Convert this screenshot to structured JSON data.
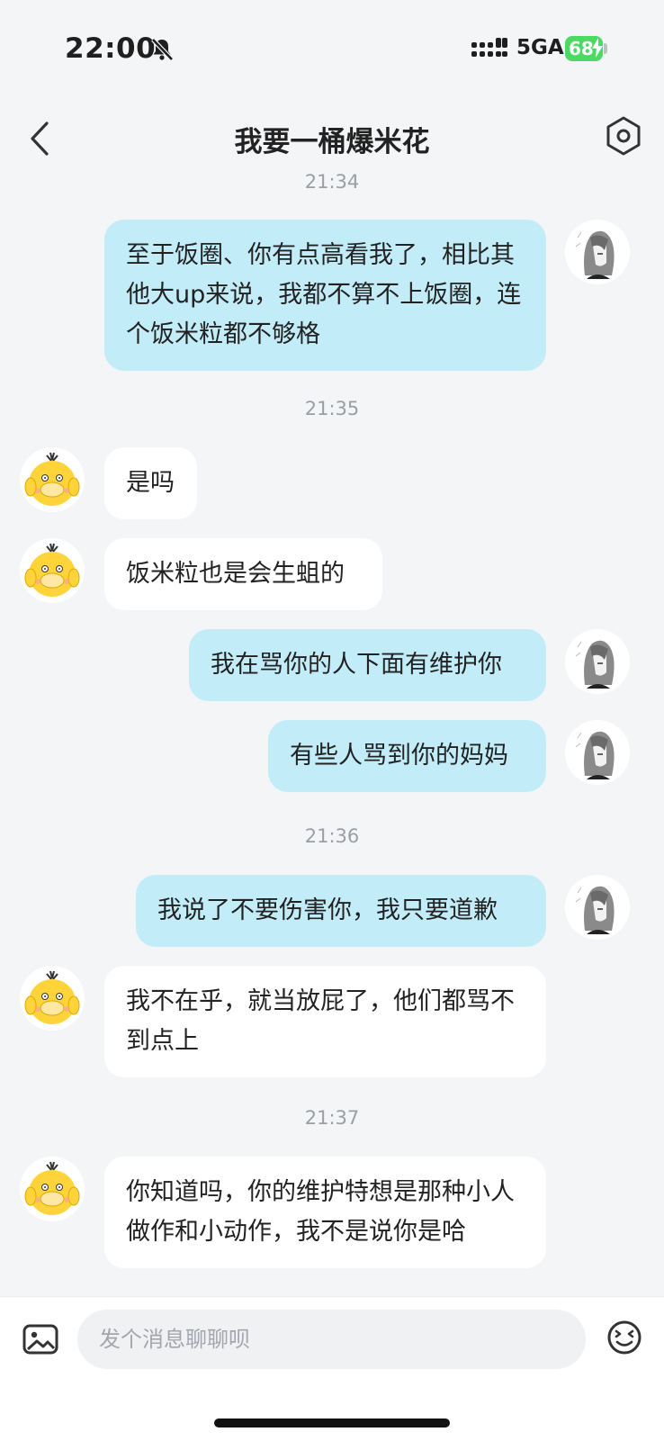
{
  "status_bar": {
    "time": "22:00",
    "network": "5GA",
    "battery": "68"
  },
  "header": {
    "title": "我要一桶爆米花",
    "back_icon": "chevron-left-icon",
    "settings_icon": "gear-icon"
  },
  "messages": [
    {
      "type": "time",
      "text": "21:34"
    },
    {
      "type": "out",
      "text": "至于饭圈、你有点高看我了，相比其他大up来说，我都不算不上饭圈，连个饭米粒都不够格"
    },
    {
      "type": "time",
      "text": "21:35"
    },
    {
      "type": "in",
      "text": "是吗"
    },
    {
      "type": "in",
      "text": "饭米粒也是会生蛆的"
    },
    {
      "type": "out",
      "text": "我在骂你的人下面有维护你"
    },
    {
      "type": "out",
      "text": "有些人骂到你的妈妈"
    },
    {
      "type": "time",
      "text": "21:36"
    },
    {
      "type": "out",
      "text": "我说了不要伤害你，我只要道歉"
    },
    {
      "type": "in",
      "text": "我不在乎，就当放屁了，他们都骂不到点上"
    },
    {
      "type": "time",
      "text": "21:37"
    },
    {
      "type": "in",
      "text": "你知道吗，你的维护特想是那种小人做作和小动作，我不是说你是哈"
    }
  ],
  "composer": {
    "placeholder": "发个消息聊聊呗",
    "image_icon": "image-icon",
    "emoji_icon": "emoji-icon"
  },
  "colors": {
    "outgoing_bubble": "#c3ecf9",
    "incoming_bubble": "#ffffff",
    "background": "#f4f5f7",
    "battery": "#4cd964"
  }
}
